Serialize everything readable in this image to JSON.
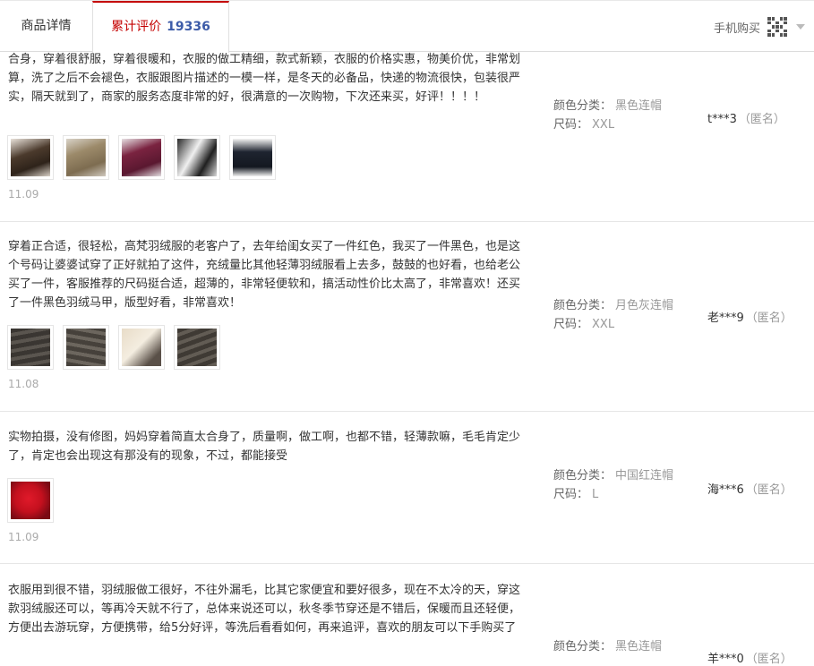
{
  "tabs": {
    "detail": "商品详情",
    "review": "累计评价",
    "review_count": "19336",
    "mobile_buy": "手机购买"
  },
  "reviews": [
    {
      "text": "合身，穿着很舒服，穿着很暖和，衣服的做工精细，款式新颖，衣服的价格实惠，物美价优，非常划算，洗了之后不会褪色，衣服跟图片描述的一模一样，是冬天的必备品，快递的物流很快，包装很严实，隔天就到了，商家的服务态度非常的好，很满意的一次购物，下次还来买，好评！！！！",
      "date": "11.09",
      "color_label": "颜色分类：",
      "color_value": "黑色连帽",
      "size_label": "尺码：",
      "size_value": "XXL",
      "user": "t***3",
      "anon": "（匿名）",
      "photos": [
        "dark-brown-coat",
        "khaki-coat",
        "wine-coat",
        "black-white-coat",
        "black-short-coat"
      ]
    },
    {
      "text": "穿着正合适，很轻松，高梵羽绒服的老客户了，去年给闺女买了一件红色，我买了一件黑色，也是这个号码让婆婆试穿了正好就拍了这件，充绒量比其他轻薄羽绒服看上去多，鼓鼓的也好看，也给老公买了一件，客服推荐的尺码挺合适，超薄的，非常轻便软和，搞活动性价比太高了，非常喜欢！还买了一件黑色羽绒马甲，版型好看，非常喜欢！",
      "date": "11.08",
      "color_label": "颜色分类：",
      "color_value": "月色灰连帽",
      "size_label": "尺码：",
      "size_value": "XXL",
      "user": "老***9",
      "anon": "（匿名）",
      "photos": [
        "grey-quilted-1",
        "grey-quilted-2",
        "beige-fabric",
        "grey-quilted-3"
      ]
    },
    {
      "text": "实物拍摄，没有修图，妈妈穿着简直太合身了，质量啊，做工啊，也都不错，轻薄款嘛，毛毛肯定少了，肯定也会出现这有那没有的现象，不过，都能接受",
      "date": "11.09",
      "color_label": "颜色分类：",
      "color_value": "中国红连帽",
      "size_label": "尺码：",
      "size_value": "L",
      "user": "海***6",
      "anon": "（匿名）",
      "photos": [
        "red-coat"
      ]
    },
    {
      "text": "衣服用到很不错，羽绒服做工很好，不往外漏毛，比其它家便宜和要好很多，现在不太冷的天，穿这款羽绒服还可以，等再冷天就不行了，总体来说还可以，秋冬季节穿还是不错后，保暖而且还轻便，方便出去游玩穿，方便携带，给5分好评，等洗后看看如何，再来追评，喜欢的朋友可以下手购买了",
      "color_label": "颜色分类：",
      "color_value": "黑色连帽",
      "user": "羊***0",
      "anon": "（匿名）"
    }
  ],
  "colors": {
    "accent": "#c40000",
    "count": "#3c5ba8"
  }
}
